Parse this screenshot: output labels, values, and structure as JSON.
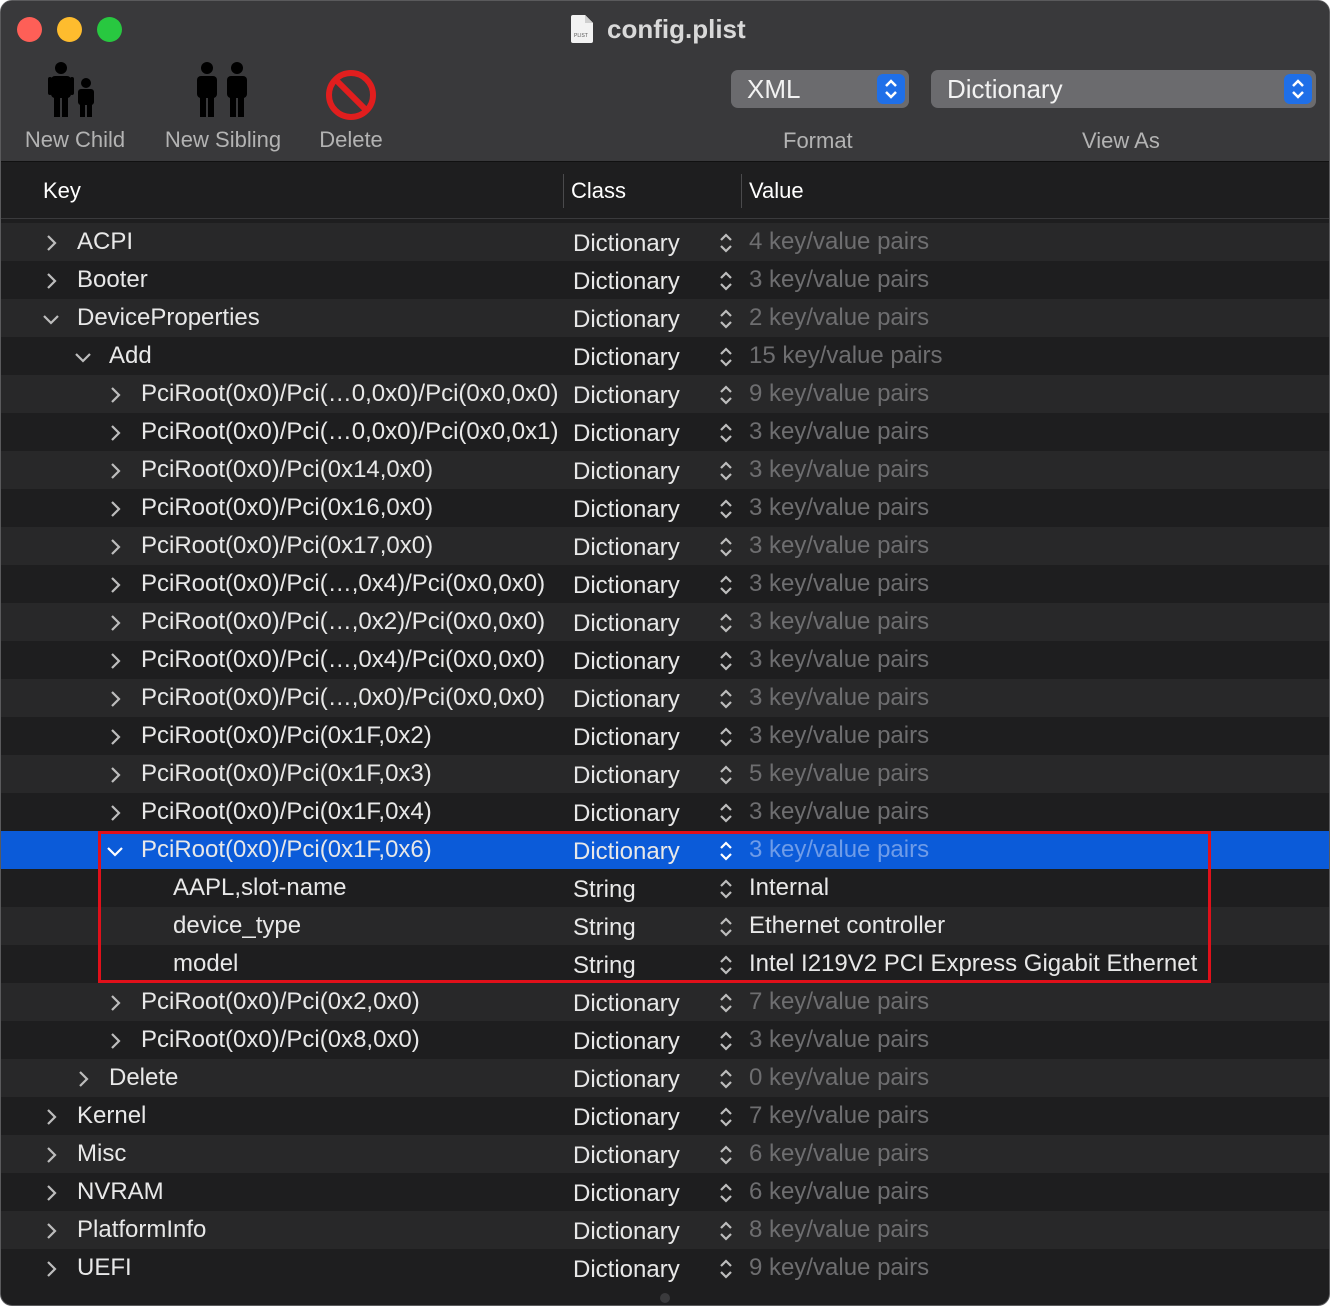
{
  "window": {
    "title": "config.plist",
    "doc_icon_text": "PLIST"
  },
  "toolbar": {
    "new_child": "New Child",
    "new_sibling": "New Sibling",
    "delete": "Delete",
    "format_value": "XML",
    "format_caption": "Format",
    "view_value": "Dictionary",
    "view_caption": "View As"
  },
  "columns": {
    "key": "Key",
    "class": "Class",
    "value": "Value"
  },
  "colors": {
    "selection": "#0b5bd9",
    "highlight_box": "#e0101a",
    "stepper": "#1f6fe8"
  },
  "rows": [
    {
      "key": "ACPI",
      "class": "Dictionary",
      "value": "4 key/value pairs",
      "level": 0,
      "state": "collapsed",
      "dim": true
    },
    {
      "key": "Booter",
      "class": "Dictionary",
      "value": "3 key/value pairs",
      "level": 0,
      "state": "collapsed",
      "dim": true
    },
    {
      "key": "DeviceProperties",
      "class": "Dictionary",
      "value": "2 key/value pairs",
      "level": 0,
      "state": "expanded",
      "dim": true
    },
    {
      "key": "Add",
      "class": "Dictionary",
      "value": "15 key/value pairs",
      "level": 1,
      "state": "expanded",
      "dim": true
    },
    {
      "key": "PciRoot(0x0)/Pci(…0,0x0)/Pci(0x0,0x0)",
      "class": "Dictionary",
      "value": "9 key/value pairs",
      "level": 2,
      "state": "collapsed",
      "dim": true
    },
    {
      "key": "PciRoot(0x0)/Pci(…0,0x0)/Pci(0x0,0x1)",
      "class": "Dictionary",
      "value": "3 key/value pairs",
      "level": 2,
      "state": "collapsed",
      "dim": true
    },
    {
      "key": "PciRoot(0x0)/Pci(0x14,0x0)",
      "class": "Dictionary",
      "value": "3 key/value pairs",
      "level": 2,
      "state": "collapsed",
      "dim": true
    },
    {
      "key": "PciRoot(0x0)/Pci(0x16,0x0)",
      "class": "Dictionary",
      "value": "3 key/value pairs",
      "level": 2,
      "state": "collapsed",
      "dim": true
    },
    {
      "key": "PciRoot(0x0)/Pci(0x17,0x0)",
      "class": "Dictionary",
      "value": "3 key/value pairs",
      "level": 2,
      "state": "collapsed",
      "dim": true
    },
    {
      "key": "PciRoot(0x0)/Pci(…,0x4)/Pci(0x0,0x0)",
      "class": "Dictionary",
      "value": "3 key/value pairs",
      "level": 2,
      "state": "collapsed",
      "dim": true
    },
    {
      "key": "PciRoot(0x0)/Pci(…,0x2)/Pci(0x0,0x0)",
      "class": "Dictionary",
      "value": "3 key/value pairs",
      "level": 2,
      "state": "collapsed",
      "dim": true
    },
    {
      "key": "PciRoot(0x0)/Pci(…,0x4)/Pci(0x0,0x0)",
      "class": "Dictionary",
      "value": "3 key/value pairs",
      "level": 2,
      "state": "collapsed",
      "dim": true
    },
    {
      "key": "PciRoot(0x0)/Pci(…,0x0)/Pci(0x0,0x0)",
      "class": "Dictionary",
      "value": "3 key/value pairs",
      "level": 2,
      "state": "collapsed",
      "dim": true
    },
    {
      "key": "PciRoot(0x0)/Pci(0x1F,0x2)",
      "class": "Dictionary",
      "value": "3 key/value pairs",
      "level": 2,
      "state": "collapsed",
      "dim": true
    },
    {
      "key": "PciRoot(0x0)/Pci(0x1F,0x3)",
      "class": "Dictionary",
      "value": "5 key/value pairs",
      "level": 2,
      "state": "collapsed",
      "dim": true
    },
    {
      "key": "PciRoot(0x0)/Pci(0x1F,0x4)",
      "class": "Dictionary",
      "value": "3 key/value pairs",
      "level": 2,
      "state": "collapsed",
      "dim": true
    },
    {
      "key": "PciRoot(0x0)/Pci(0x1F,0x6)",
      "class": "Dictionary",
      "value": "3 key/value pairs",
      "level": 2,
      "state": "expanded",
      "dim": true,
      "selected": true
    },
    {
      "key": "AAPL,slot-name",
      "class": "String",
      "value": "Internal",
      "level": 3,
      "state": "leaf",
      "dim": false
    },
    {
      "key": "device_type",
      "class": "String",
      "value": "Ethernet controller",
      "level": 3,
      "state": "leaf",
      "dim": false
    },
    {
      "key": "model",
      "class": "String",
      "value": "Intel I219V2 PCI Express Gigabit Ethernet",
      "level": 3,
      "state": "leaf",
      "dim": false
    },
    {
      "key": "PciRoot(0x0)/Pci(0x2,0x0)",
      "class": "Dictionary",
      "value": "7 key/value pairs",
      "level": 2,
      "state": "collapsed",
      "dim": true
    },
    {
      "key": "PciRoot(0x0)/Pci(0x8,0x0)",
      "class": "Dictionary",
      "value": "3 key/value pairs",
      "level": 2,
      "state": "collapsed",
      "dim": true
    },
    {
      "key": "Delete",
      "class": "Dictionary",
      "value": "0 key/value pairs",
      "level": 1,
      "state": "collapsed",
      "dim": true
    },
    {
      "key": "Kernel",
      "class": "Dictionary",
      "value": "7 key/value pairs",
      "level": 0,
      "state": "collapsed",
      "dim": true
    },
    {
      "key": "Misc",
      "class": "Dictionary",
      "value": "6 key/value pairs",
      "level": 0,
      "state": "collapsed",
      "dim": true
    },
    {
      "key": "NVRAM",
      "class": "Dictionary",
      "value": "6 key/value pairs",
      "level": 0,
      "state": "collapsed",
      "dim": true
    },
    {
      "key": "PlatformInfo",
      "class": "Dictionary",
      "value": "8 key/value pairs",
      "level": 0,
      "state": "collapsed",
      "dim": true
    },
    {
      "key": "UEFI",
      "class": "Dictionary",
      "value": "9 key/value pairs",
      "level": 0,
      "state": "collapsed",
      "dim": true
    }
  ]
}
